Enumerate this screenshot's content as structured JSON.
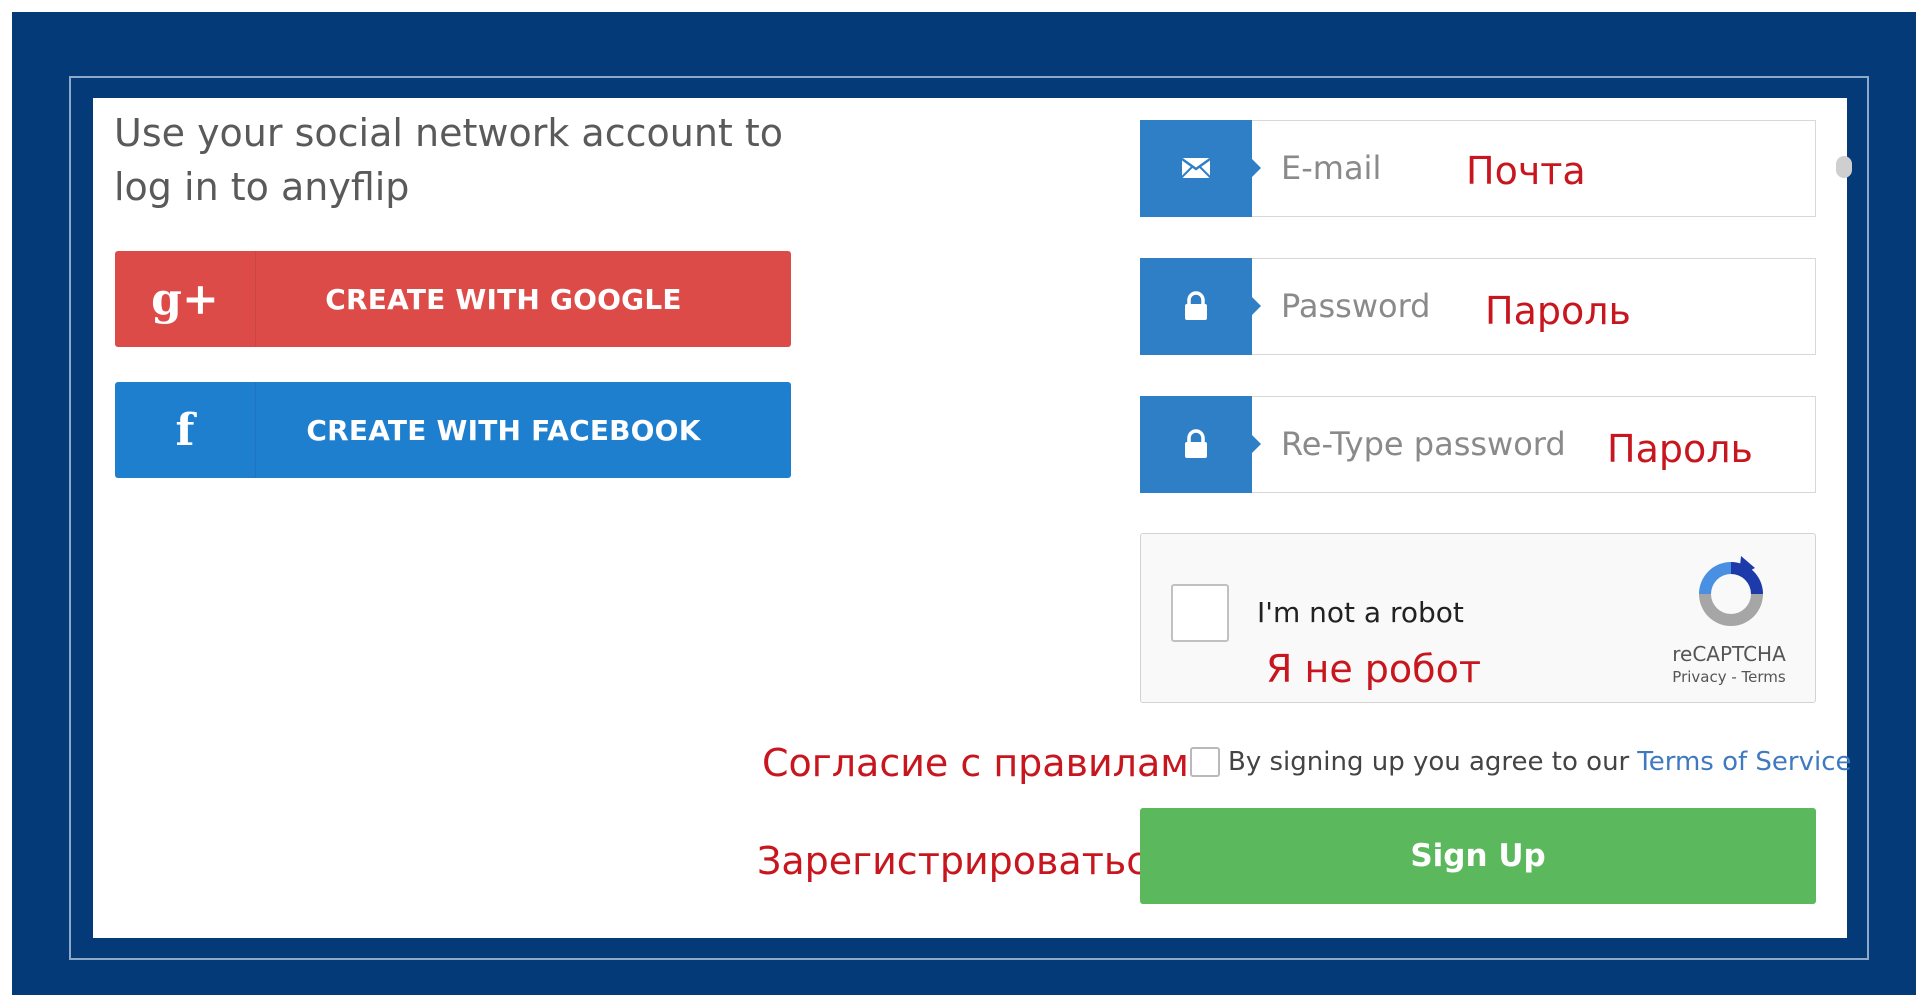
{
  "intro": {
    "text": "Use your social network account to log in to anyflip"
  },
  "social": {
    "google": {
      "label": "CREATE WITH GOOGLE",
      "icon": "google-plus-icon",
      "icon_glyph": "g+",
      "color": "#dd4b48"
    },
    "facebook": {
      "label": "CREATE WITH FACEBOOK",
      "icon": "facebook-icon",
      "icon_glyph": "f",
      "color": "#1f7fcf"
    }
  },
  "form": {
    "email": {
      "placeholder": "E-mail",
      "value": "",
      "icon": "envelope-icon",
      "annotation": "Почта"
    },
    "password": {
      "placeholder": "Password",
      "value": "",
      "icon": "lock-icon",
      "annotation": "Пароль"
    },
    "retype": {
      "placeholder": "Re-Type password",
      "value": "",
      "icon": "lock-icon",
      "annotation": "Пароль"
    }
  },
  "captcha": {
    "label": "I'm not a robot",
    "brand": "reCAPTCHA",
    "links": "Privacy - Terms",
    "annotation": "Я не робот"
  },
  "terms": {
    "text": "By signing up you agree to our",
    "link": "Terms of Service",
    "annotation": "Согласие с правилами"
  },
  "signup": {
    "label": "Sign Up",
    "annotation": "Зарегистрироваться",
    "color": "#5cb85c"
  },
  "colors": {
    "background": "#043a78",
    "field_icon": "#2f7fc7",
    "annotation": "#c8161e"
  }
}
